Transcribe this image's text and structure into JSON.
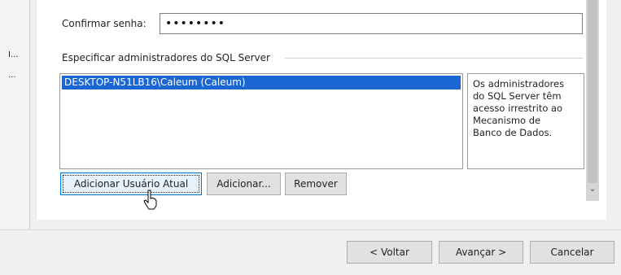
{
  "form": {
    "confirm_password_label": "Confirmar senha:",
    "confirm_password_value": "••••••••",
    "group_label": "Especificar administradores do SQL Server",
    "administrators": [
      "DESKTOP-N51LB16\\Caleum (Caleum)"
    ],
    "info_text": [
      "Os administradores",
      "do SQL Server têm",
      "acesso irrestrito ao",
      "Mecanismo de",
      "Banco de Dados."
    ],
    "buttons": {
      "add_current_user": "Adicionar Usuário Atual",
      "add": "Adicionar...",
      "remove": "Remover"
    }
  },
  "left_strip": {
    "item1": "I...",
    "item2": "..."
  },
  "footer": {
    "back": "< Voltar",
    "next": "Avançar >",
    "cancel": "Cancelar"
  },
  "icons": {
    "scroll_down": "chevron-down-icon",
    "cursor": "hand-cursor-icon"
  },
  "colors": {
    "selection": "#1a66d2",
    "focus_border": "#0078d7"
  }
}
